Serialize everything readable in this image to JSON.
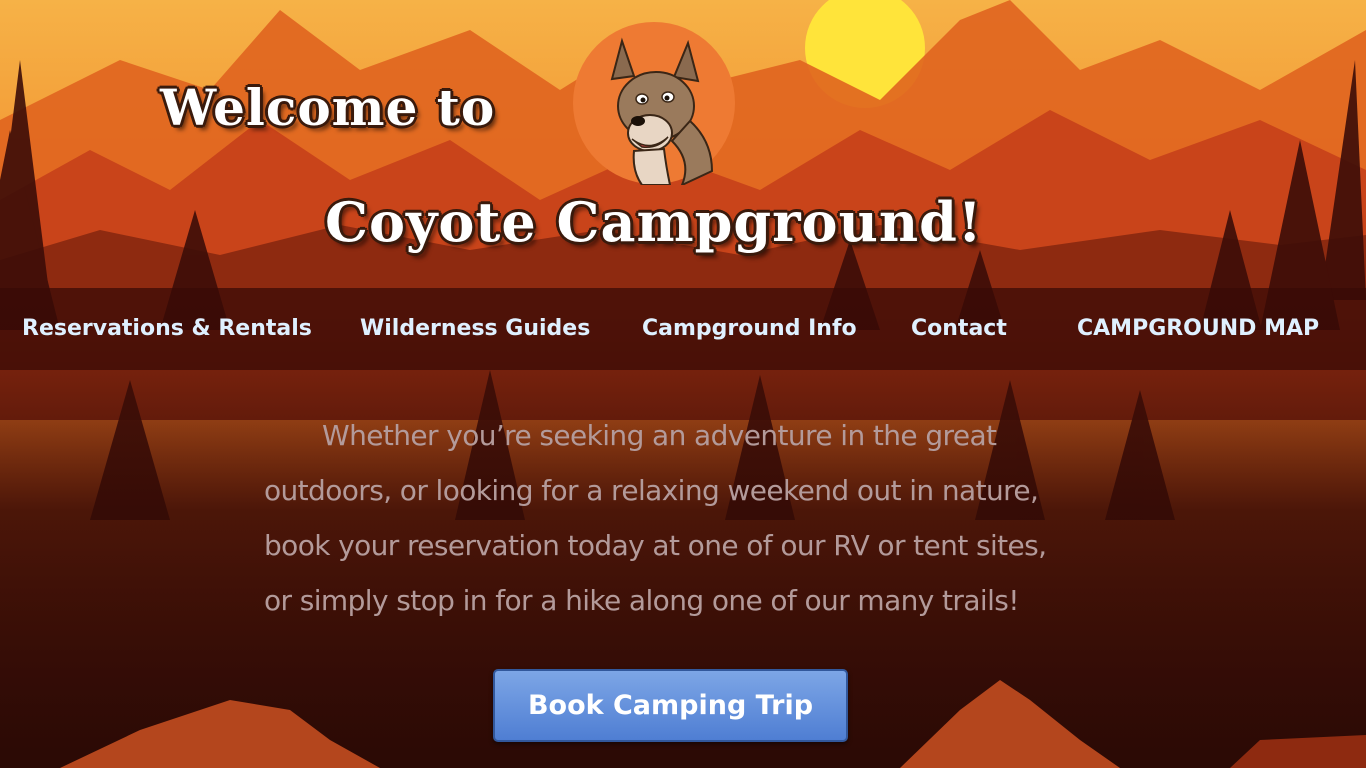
{
  "header": {
    "title_line1": "Welcome to",
    "title_line2": "Coyote Campground!",
    "mascot_icon": "coyote-mascot-icon"
  },
  "nav": {
    "items": [
      {
        "label": "Reservations & Rentals"
      },
      {
        "label": "Wilderness Guides"
      },
      {
        "label": "Campground Info"
      },
      {
        "label": "Contact"
      },
      {
        "label": "CAMPGROUND MAP"
      }
    ]
  },
  "intro": {
    "lines": [
      "Whether you’re seeking an adventure in the great",
      "outdoors, or looking for a relaxing weekend out in nature,",
      "book your reservation today at one of our RV or tent sites,",
      "or simply stop in for a hike along one of our many trails!"
    ]
  },
  "cta": {
    "label": "Book Camping Trip"
  },
  "colors": {
    "nav_text": "#dff0ff",
    "intro_text": "#b39a9a",
    "button": "#5f8cd9",
    "background": "#2b0a05",
    "sky_orange": "#f08a2a",
    "mountain": "#c9441a"
  }
}
